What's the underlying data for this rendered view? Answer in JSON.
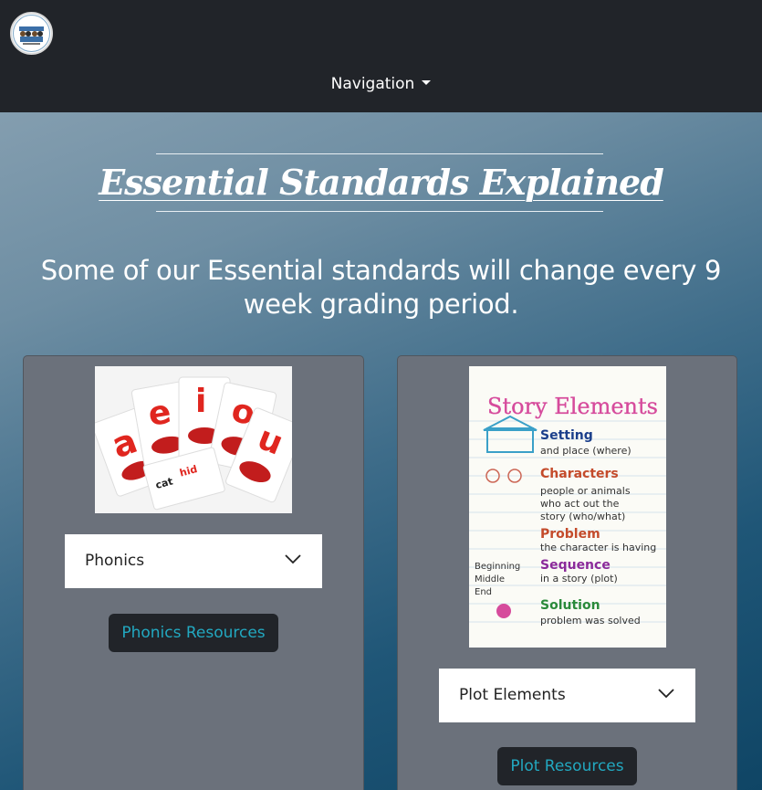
{
  "header": {
    "nav_label": "Navigation"
  },
  "hero": {
    "title": "Essential Standards Explained",
    "subtitle": "Some of our Essential standards will change every 9 week grading period."
  },
  "cards": [
    {
      "image_alt": "vowel-mouth-cards",
      "select_value": "Phonics",
      "button_label": "Phonics Resources"
    },
    {
      "image_alt": "story-elements-anchor-chart",
      "select_value": "Plot Elements",
      "button_label": "Plot Resources"
    }
  ],
  "colors": {
    "navbar": "#212429",
    "card": "#6b717b",
    "button_text": "#22a8c0"
  }
}
